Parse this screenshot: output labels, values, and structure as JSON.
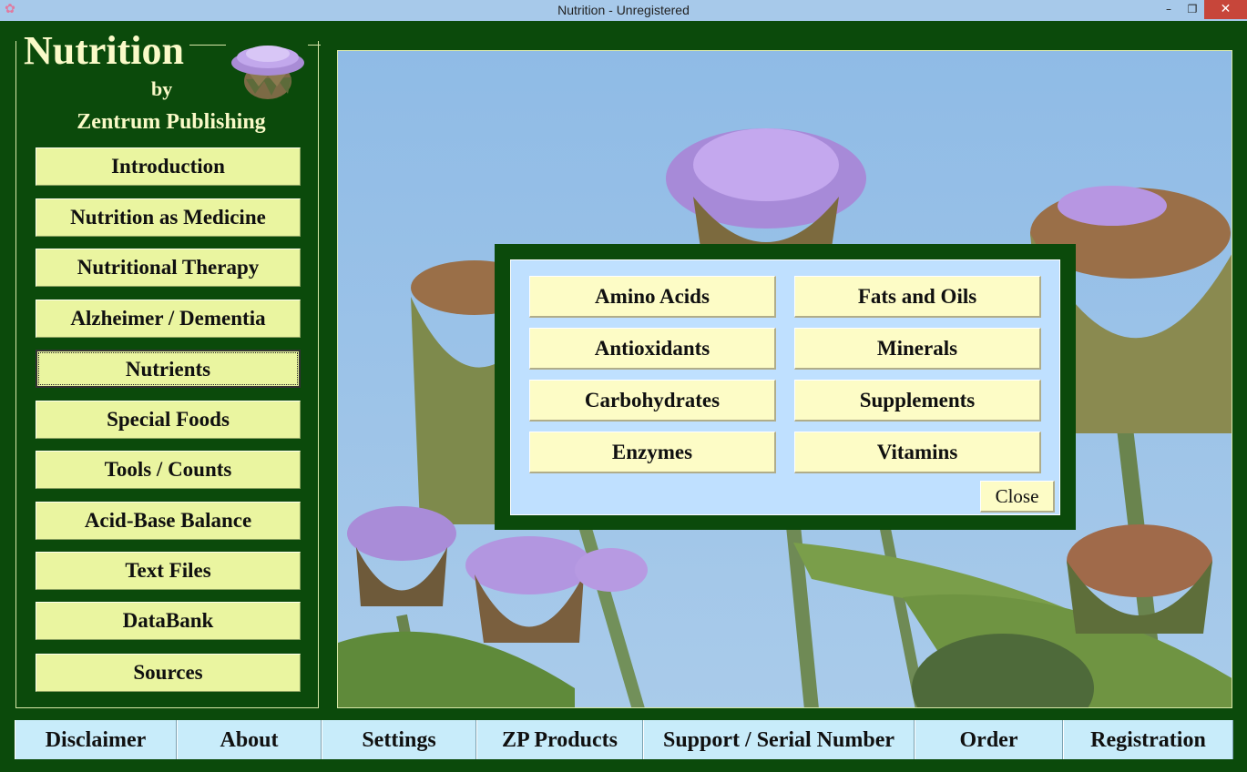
{
  "window": {
    "title": "Nutrition - Unregistered",
    "minimize": "–",
    "maximize": "❐",
    "close": "✕"
  },
  "sidebar": {
    "app_title": "Nutrition",
    "by": "by",
    "publisher": "Zentrum Publishing",
    "items": [
      {
        "label": "Introduction"
      },
      {
        "label": "Nutrition as Medicine"
      },
      {
        "label": "Nutritional Therapy"
      },
      {
        "label": "Alzheimer / Dementia"
      },
      {
        "label": "Nutrients"
      },
      {
        "label": "Special Foods"
      },
      {
        "label": "Tools / Counts"
      },
      {
        "label": "Acid-Base Balance"
      },
      {
        "label": "Text Files"
      },
      {
        "label": "DataBank"
      },
      {
        "label": "Sources"
      }
    ],
    "active_item": "Nutrients"
  },
  "dialog": {
    "buttons": [
      {
        "label": "Amino Acids"
      },
      {
        "label": "Fats and Oils"
      },
      {
        "label": "Antioxidants"
      },
      {
        "label": "Minerals"
      },
      {
        "label": "Carbohydrates"
      },
      {
        "label": "Supplements"
      },
      {
        "label": "Enzymes"
      },
      {
        "label": "Vitamins"
      }
    ],
    "close_label": "Close"
  },
  "bottom_bar": {
    "items": [
      {
        "label": "Disclaimer"
      },
      {
        "label": "About"
      },
      {
        "label": "Settings"
      },
      {
        "label": "ZP Products"
      },
      {
        "label": "Support / Serial Number"
      },
      {
        "label": "Order"
      },
      {
        "label": "Registration"
      }
    ]
  },
  "colors": {
    "frame_green": "#0b4a0b",
    "nav_button": "#eaf5a0",
    "dialog_bg": "#bfe0ff",
    "dialog_button": "#fdfcc6",
    "bottom_bar": "#c8ecfa",
    "sky": "#8fbbe6"
  }
}
